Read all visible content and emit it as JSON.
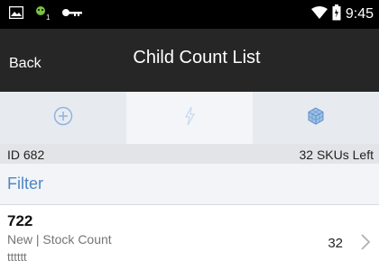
{
  "status_bar": {
    "time": "9:45",
    "icons": [
      "image-icon",
      "android-notification-icon",
      "key-icon",
      "wifi-icon",
      "battery-icon"
    ]
  },
  "header": {
    "back_label": "Back",
    "title": "Child Count List"
  },
  "tabs": [
    {
      "icon": "add-circle-icon",
      "selected": false
    },
    {
      "icon": "flash-icon",
      "selected": true
    },
    {
      "icon": "cube-icon",
      "selected": false
    }
  ],
  "info": {
    "id_label": "ID 682",
    "skus_left": "32 SKUs Left"
  },
  "filter": {
    "label": "Filter"
  },
  "items": [
    {
      "id": "722",
      "status": "New | Stock Count",
      "description": "tttttt",
      "count": "32"
    }
  ],
  "colors": {
    "header_bg": "#262626",
    "accent": "#4e86c4",
    "tab_bg": "#e7ebf0"
  }
}
